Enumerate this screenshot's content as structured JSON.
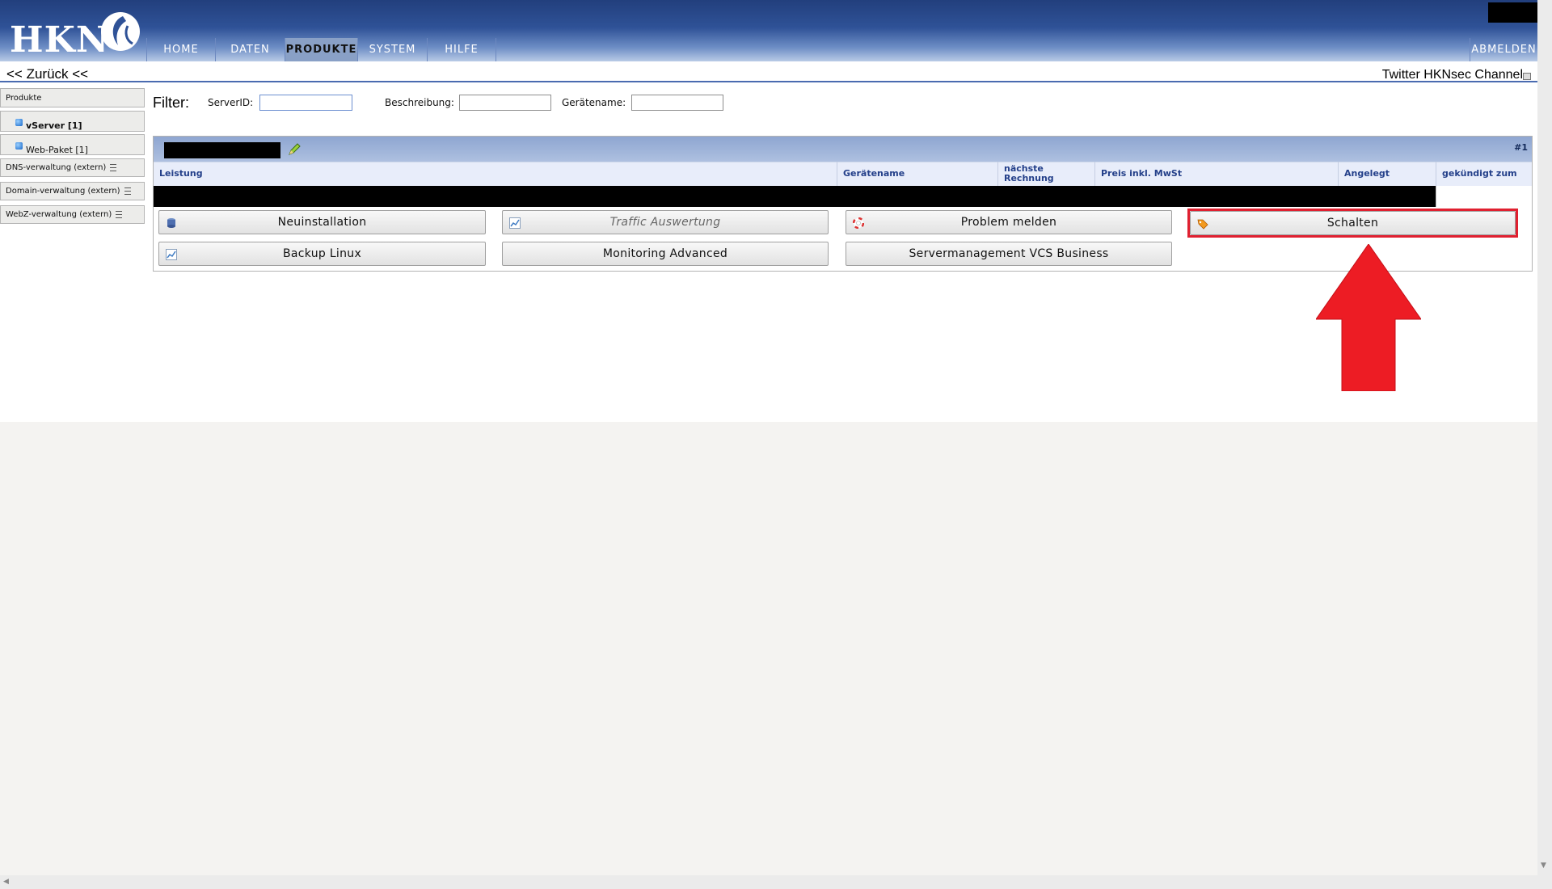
{
  "header": {
    "logo_text": "HKN",
    "nav": [
      "HOME",
      "DATEN",
      "PRODUKTE",
      "SYSTEM",
      "HILFE"
    ],
    "active_nav": "PRODUKTE",
    "logout": "ABMELDEN"
  },
  "topbar": {
    "back": "<< Zurück <<",
    "twitter": "Twitter HKNsec Channel"
  },
  "sidebar": {
    "products": "Produkte",
    "vserver": "vServer [1]",
    "webpaket": "Web-Paket [1]",
    "dns": "DNS-verwaltung (extern)",
    "domain": "Domain-verwaltung (extern)",
    "webz": "WebZ-verwaltung (extern)"
  },
  "filter": {
    "label": "Filter:",
    "serverid_label": "ServerID:",
    "beschreibung_label": "Beschreibung:",
    "geraetename_label": "Gerätename:",
    "serverid_value": "",
    "beschreibung_value": "",
    "geraetename_value": ""
  },
  "table": {
    "row_number": "#1",
    "columns": {
      "leistung": "Leistung",
      "geraetename": "Gerätename",
      "naechste": "nächste Rechnung",
      "preis": "Preis inkl. MwSt",
      "angelegt": "Angelegt",
      "gekuendigt": "gekündigt zum"
    }
  },
  "actions": {
    "neuinstallation": "Neuinstallation",
    "traffic": "Traffic Auswertung",
    "problem": "Problem melden",
    "schalten": "Schalten",
    "backup": "Backup Linux",
    "monitoring": "Monitoring Advanced",
    "servermanagement": "Servermanagement VCS Business"
  },
  "colors": {
    "header_blue": "#2f5297",
    "highlight_red": "#e02030",
    "arrow_red": "#ed1c24"
  }
}
